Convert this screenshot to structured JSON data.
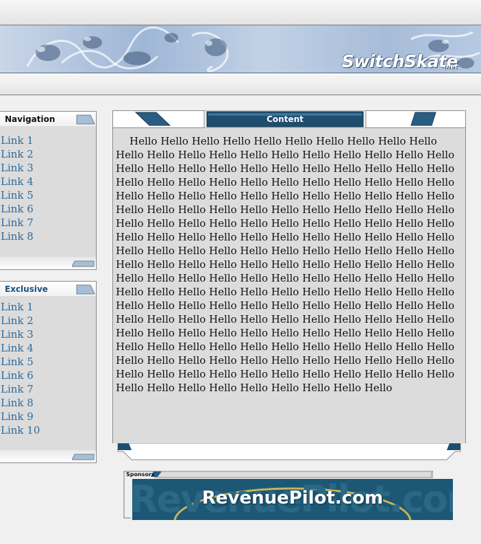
{
  "site": {
    "brand": "SwitchSkate",
    "brand_tld": ".net"
  },
  "navigation": {
    "title": "Navigation",
    "links": [
      "Link 1",
      "Link 2",
      "Link 3",
      "Link 4",
      "Link 5",
      "Link 6",
      "Link 7",
      "Link 8"
    ]
  },
  "exclusive": {
    "title": "Exclusive",
    "links": [
      "Link 1",
      "Link 2",
      "Link 3",
      "Link 4",
      "Link 5",
      "Link 6",
      "Link 7",
      "Link 8",
      "Link 9",
      "Link 10"
    ]
  },
  "content": {
    "title": "Content",
    "body": "Hello Hello Hello Hello Hello Hello Hello Hello Hello Hello Hello Hello Hello Hello Hello Hello Hello Hello Hello Hello Hello Hello Hello Hello Hello Hello Hello Hello Hello Hello Hello Hello Hello Hello Hello Hello Hello Hello Hello Hello Hello Hello Hello Hello Hello Hello Hello Hello Hello Hello Hello Hello Hello Hello Hello Hello Hello Hello Hello Hello Hello Hello Hello Hello Hello Hello Hello Hello Hello Hello Hello Hello Hello Hello Hello Hello Hello Hello Hello Hello Hello Hello Hello Hello Hello Hello Hello Hello Hello Hello Hello Hello Hello Hello Hello Hello Hello Hello Hello Hello Hello Hello Hello Hello Hello Hello Hello Hello Hello Hello Hello Hello Hello Hello Hello Hello Hello Hello Hello Hello Hello Hello Hello Hello Hello Hello Hello Hello Hello Hello Hello Hello Hello Hello Hello Hello Hello Hello Hello Hello Hello Hello Hello Hello Hello Hello Hello Hello Hello Hello Hello Hello Hello Hello Hello Hello Hello Hello Hello Hello Hello Hello Hello Hello Hello Hello Hello Hello Hello Hello Hello Hello Hello Hello Hello Hello Hello Hello Hello Hello Hello Hello Hello Hello Hello Hello Hello Hello Hello Hello Hello Hello Hello Hello Hello Hello Hello Hello Hello Hello Hello Hello Hello Hello Hello Hello"
  },
  "sponsors": {
    "label": "Sponsors",
    "ad_text": "RevenuePilot.com"
  },
  "colors": {
    "link": "#2f6a9a",
    "header_dark": "#1d4e70",
    "panel_bg": "#dcdcdc"
  }
}
